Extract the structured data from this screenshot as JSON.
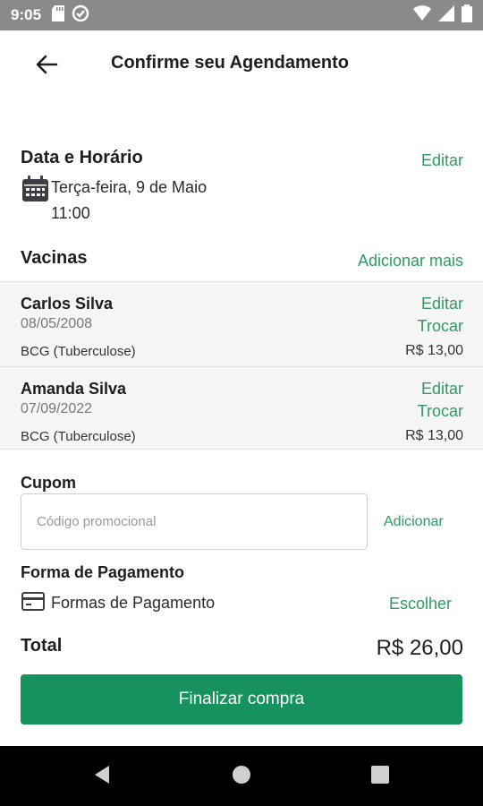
{
  "status_bar": {
    "time": "9:05"
  },
  "header": {
    "title": "Confirme seu Agendamento"
  },
  "schedule": {
    "section_title": "Data e Horário",
    "edit_label": "Editar",
    "date": "Terça-feira, 9 de Maio",
    "time": "11:00"
  },
  "vaccines": {
    "section_title": "Vacinas",
    "add_more_label": "Adicionar mais",
    "items": [
      {
        "name": "Carlos Silva",
        "birth_date": "08/05/2008",
        "vaccine": "BCG (Tuberculose)",
        "price": "R$ 13,00",
        "edit_label": "Editar",
        "swap_label": "Trocar"
      },
      {
        "name": "Amanda Silva",
        "birth_date": "07/09/2022",
        "vaccine": "BCG (Tuberculose)",
        "price": "R$ 13,00",
        "edit_label": "Editar",
        "swap_label": "Trocar"
      }
    ]
  },
  "coupon": {
    "section_title": "Cupom",
    "placeholder": "Código promocional",
    "value": "",
    "add_label": "Adicionar"
  },
  "payment": {
    "section_title": "Forma de Pagamento",
    "method_label": "Formas de Pagamento",
    "choose_label": "Escolher"
  },
  "total": {
    "label": "Total",
    "value": "R$ 26,00"
  },
  "finalize": {
    "label": "Finalizar compra"
  },
  "colors": {
    "accent": "#2e9a63",
    "button": "#16925e",
    "status_bar": "#8a8a8a"
  }
}
